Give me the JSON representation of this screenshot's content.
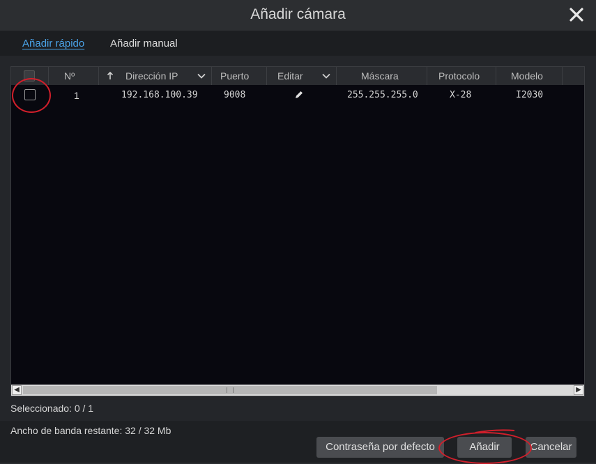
{
  "dialog": {
    "title": "Añadir cámara"
  },
  "tabs": [
    {
      "label": "Añadir rápido",
      "active": true
    },
    {
      "label": "Añadir manual",
      "active": false
    }
  ],
  "table": {
    "columns": {
      "number": "Nº",
      "ip": "Dirección IP",
      "port": "Puerto",
      "edit": "Editar",
      "mask": "Máscara",
      "protocol": "Protocolo",
      "model": "Modelo"
    },
    "rows": [
      {
        "number": "1",
        "ip": "192.168.100.39",
        "port": "9008",
        "mask": "255.255.255.0",
        "protocol": "X-28",
        "model": "I2030"
      }
    ]
  },
  "status": {
    "selected": "Seleccionado: 0 / 1",
    "bandwidth": "Ancho de banda restante: 32 / 32 Mb"
  },
  "buttons": {
    "default_password": "Contraseña por defecto",
    "add": "Añadir",
    "cancel": "Cancelar"
  },
  "colors": {
    "accent": "#4aa3e8",
    "annotation": "#d21f2b"
  },
  "icons": {
    "close": "close-icon",
    "sort": "arrow-up-icon",
    "filter": "chevron-down-icon",
    "edit": "pencil-icon"
  }
}
